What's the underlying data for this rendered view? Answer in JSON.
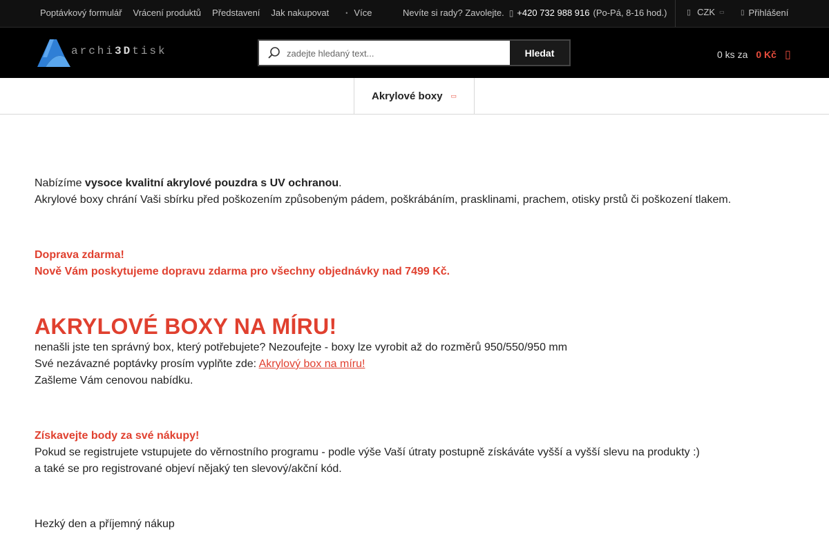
{
  "topbar": {
    "links": [
      "Poptávkový formulář",
      "Vrácení produktů",
      "Představení",
      "Jak nakupovat"
    ],
    "more_label": "Více",
    "contact_prefix": "Nevíte si rady? Zavolejte.",
    "phone": "+420 732 988 916",
    "hours": "(Po-Pá, 8-16 hod.)",
    "currency": "CZK",
    "login_label": "Přihlášení"
  },
  "header": {
    "logo_prefix": "archi",
    "logo_3d": "3D",
    "logo_suffix": "tisk",
    "search_placeholder": "zadejte hledaný text...",
    "search_button": "Hledat",
    "cart_count": "0 ks za",
    "cart_price": "0 Kč"
  },
  "nav": {
    "item_label": "Akrylové boxy"
  },
  "content": {
    "intro_prefix": "Nabízíme ",
    "intro_bold": "vysoce kvalitní akrylové pouzdra s UV ochranou",
    "intro_suffix": ".",
    "intro_line2": "Akrylové boxy chrání Vaši sbírku před poškozením způsobeným pádem, poškrábáním, prasklinami, prachem, otisky prstů či poškození tlakem.",
    "shipping_title": "Doprava zdarma!",
    "shipping_text": "Nově Vám poskytujeme dopravu zdarma pro všechny objednávky nad 7499 Kč.",
    "custom_heading": "AKRYLOVÉ BOXY NA MÍRU!",
    "custom_line1": "nenašli jste ten správný box, který potřebujete? Nezoufejte - boxy lze vyrobit až do rozměrů 950/550/950 mm",
    "custom_line2_prefix": "Své nezávazné poptávky prosím vyplňte zde: ",
    "custom_link": "Akrylový box na míru!",
    "custom_line3": "Zašleme Vám cenovou nabídku.",
    "points_title": "Získavejte body za své nákupy!",
    "points_line1": "Pokud se registrujete vstupujete do věrnostního programu - podle výše Vaší útraty postupně získáváte vyšší a vyšší slevu na produkty :)",
    "points_line2": "a také se pro registrované objeví nějaký ten slevový/akční kód.",
    "closing": "Hezký den a příjemný nákup"
  },
  "colors": {
    "accent": "#e0402f",
    "topbar_bg": "#111111",
    "header_bg": "#000000",
    "logo_blue": "#2f7fd6"
  }
}
